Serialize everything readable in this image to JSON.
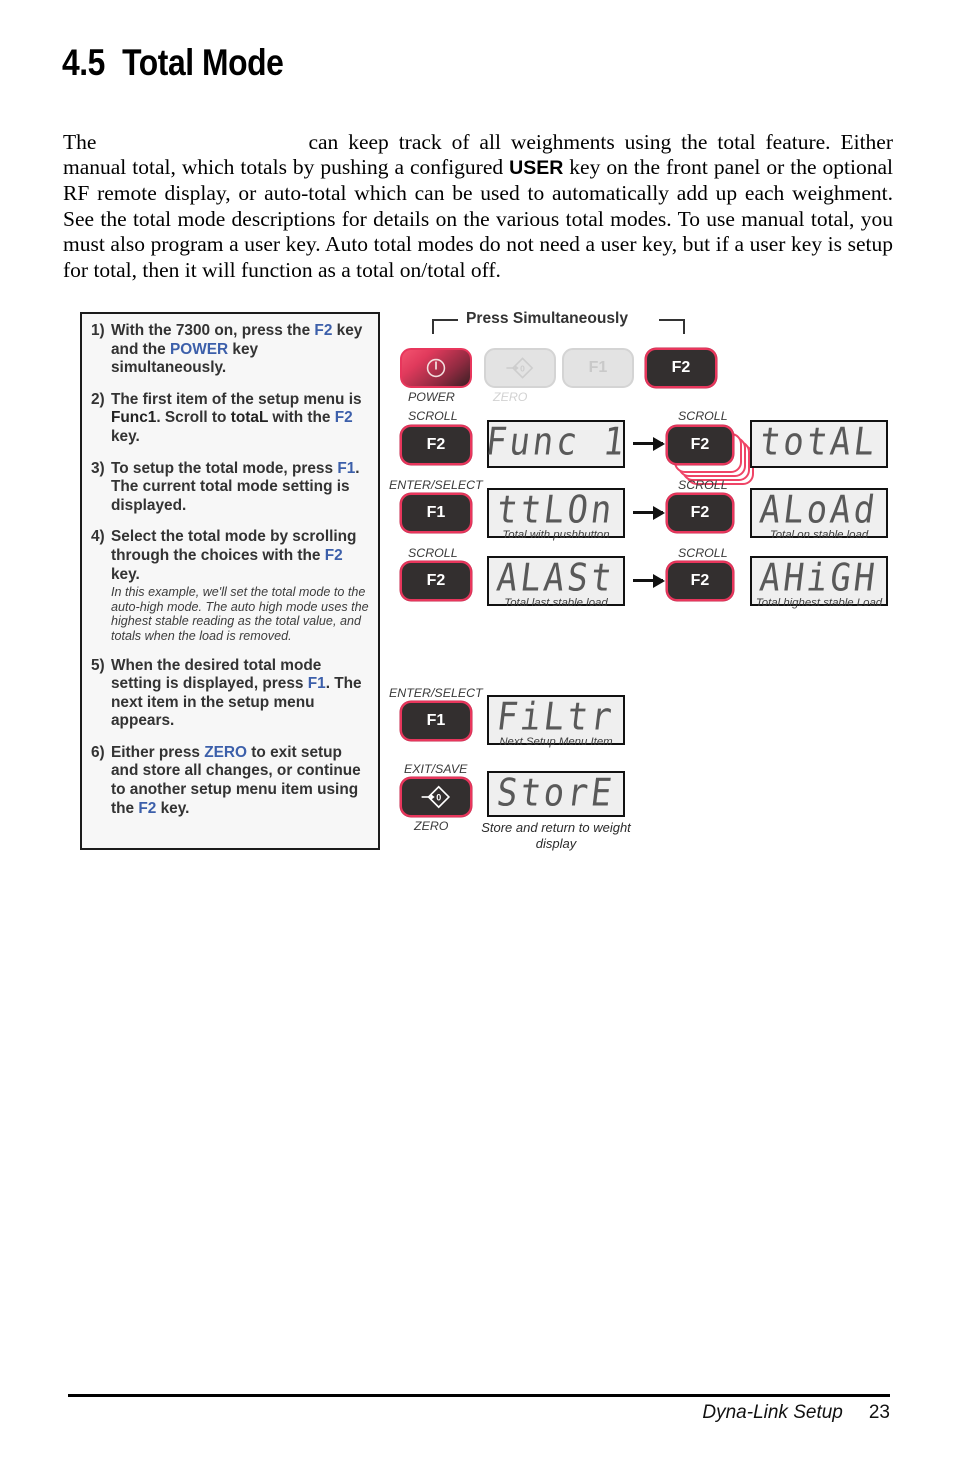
{
  "heading": {
    "number": "4.5",
    "title": "Total Mode"
  },
  "body": {
    "part1": "The",
    "part2": "can keep track of all weighments using the total feature. Either manual total, which totals by pushing a configured",
    "emphasis": "USER",
    "part3": "key on the front panel or the optional RF remote display, or auto-total which can be used to automatically add up each weighment. See the total mode descriptions for details on the various total modes. To use manual total, you must also program a user key. Auto total modes do not need a user key, but if a user key is setup for total, then it will function as a total on/total off."
  },
  "instructions": {
    "steps": [
      {
        "number": "1)",
        "segments": [
          {
            "t": "With the 7300 on, press the ",
            "s": "n"
          },
          {
            "t": "F2",
            "s": "k"
          },
          {
            "t": " key and the ",
            "s": "n"
          },
          {
            "t": "POWER",
            "s": "k"
          },
          {
            "t": " key simultaneously.",
            "s": "n"
          }
        ]
      },
      {
        "number": "2)",
        "segments": [
          {
            "t": "The first item of the setup menu is ",
            "s": "n"
          },
          {
            "t": "Func1",
            "s": "b"
          },
          {
            "t": ". Scroll to ",
            "s": "n"
          },
          {
            "t": "totaL",
            "s": "b"
          },
          {
            "t": " with the ",
            "s": "n"
          },
          {
            "t": "F2",
            "s": "k"
          },
          {
            "t": " key.",
            "s": "n"
          }
        ]
      },
      {
        "number": "3)",
        "segments": [
          {
            "t": "To setup the total mode, press ",
            "s": "n"
          },
          {
            "t": "F1",
            "s": "k"
          },
          {
            "t": ". The current total mode setting is displayed.",
            "s": "n"
          }
        ]
      },
      {
        "number": "4)",
        "segments": [
          {
            "t": "Select the total mode by scrolling through the choices with the ",
            "s": "n"
          },
          {
            "t": "F2",
            "s": "k"
          },
          {
            "t": " key.",
            "s": "n"
          }
        ],
        "note": "In this example, we'll set the total mode to the auto-high mode. The auto high mode uses the highest stable reading as the total value, and totals when the load is removed."
      },
      {
        "number": "5)",
        "segments": [
          {
            "t": "When the desired total mode setting is displayed, press ",
            "s": "n"
          },
          {
            "t": "F1",
            "s": "k"
          },
          {
            "t": ". The next item in the setup menu appears.",
            "s": "n"
          }
        ]
      },
      {
        "number": "6)",
        "segments": [
          {
            "t": "Either press ",
            "s": "n"
          },
          {
            "t": "ZERO",
            "s": "k"
          },
          {
            "t": " to exit setup and store all changes, or continue to another setup menu item using the ",
            "s": "n"
          },
          {
            "t": "F2",
            "s": "k"
          },
          {
            "t": " key.",
            "s": "n"
          }
        ]
      }
    ]
  },
  "diagram": {
    "bracket_label": "Press Simultaneously",
    "keypad": {
      "power": {
        "label": "POWER",
        "icon": "power-icon"
      },
      "zero": {
        "label": "ZERO",
        "icon": "zero-diamond-icon"
      },
      "f1": {
        "label": "F1"
      },
      "f2": {
        "label": "F2"
      }
    },
    "rows": [
      {
        "left_key": {
          "label": "F2",
          "function": "SCROLL"
        },
        "left_display": {
          "text": "Func 1",
          "caption": ""
        },
        "right_key": {
          "label": "F2",
          "function": "SCROLL",
          "stacked": true
        },
        "right_display": {
          "text": "totAL",
          "caption": ""
        }
      },
      {
        "left_key": {
          "label": "F1",
          "function": "ENTER/SELECT"
        },
        "left_display": {
          "text": "ttLOn",
          "caption": "Total with pushbutton"
        },
        "right_key": {
          "label": "F2",
          "function": "SCROLL"
        },
        "right_display": {
          "text": "ALoAd",
          "caption": "Total on stable load"
        }
      },
      {
        "left_key": {
          "label": "F2",
          "function": "SCROLL"
        },
        "left_display": {
          "text": "ALASt",
          "caption": "Total last stable load"
        },
        "right_key": {
          "label": "F2",
          "function": "SCROLL"
        },
        "right_display": {
          "text": "AHiGH",
          "caption": "Total highest stable Load"
        }
      }
    ],
    "final_rows": [
      {
        "key": {
          "label": "F1",
          "function": "ENTER/SELECT"
        },
        "display": {
          "text": "FiLtr",
          "caption": "Next Setup Menu Item"
        }
      },
      {
        "key": {
          "label": "ZERO",
          "function": "EXIT/SAVE",
          "icon": "zero-diamond-icon"
        },
        "display": {
          "text": "StorE",
          "caption": ""
        },
        "below_caption": "Store and return to weight display"
      }
    ]
  },
  "footer": {
    "title": "Dyna-Link Setup",
    "page": "23"
  },
  "colors": {
    "key_blue": "#3c5faa",
    "button_red": "#e8365c",
    "button_dark": "#332f2f",
    "lcd_bg": "#efefef",
    "lcd_text": "#595959"
  }
}
